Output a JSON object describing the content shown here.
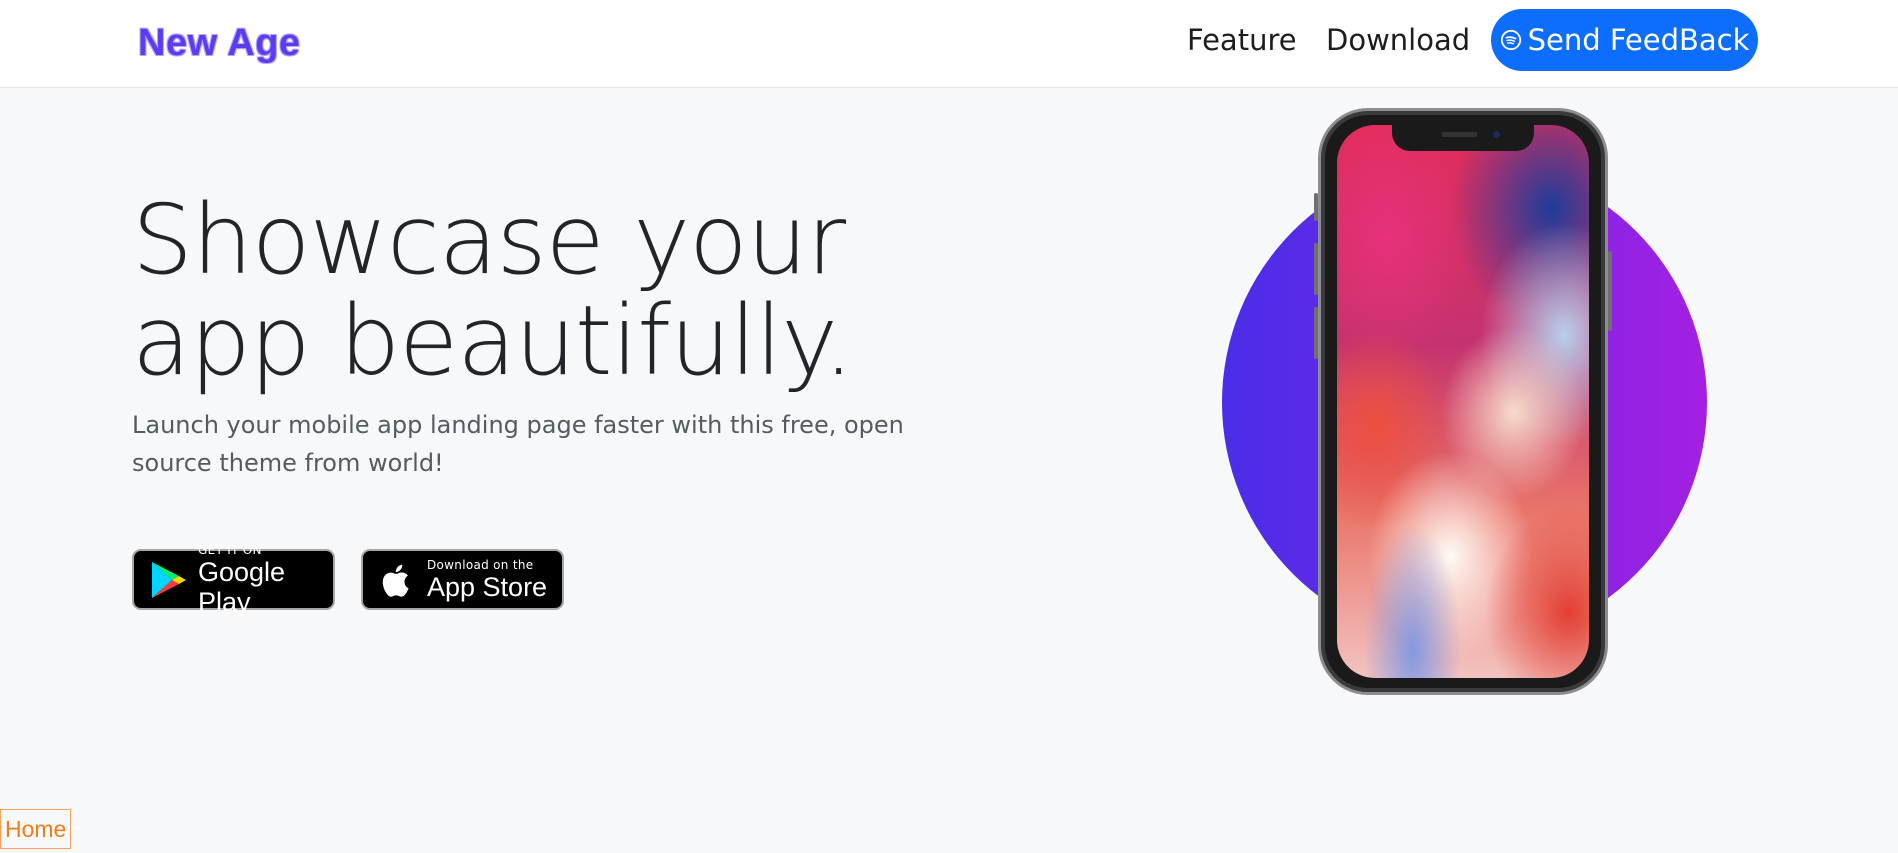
{
  "navbar": {
    "brand": "New Age",
    "links": [
      {
        "label": "Feature"
      },
      {
        "label": "Download"
      }
    ],
    "feedback_button": {
      "label": "Send FeedBack",
      "icon": "spotify-icon",
      "color": "#0d6efd"
    }
  },
  "hero": {
    "title_line1": "Showcase your",
    "title_line2": "app beautifully.",
    "lead": "Launch your mobile app landing page faster with this free, open source theme from world!",
    "badges": {
      "google": {
        "small": "GET IT ON",
        "large": "Google Play",
        "icon": "google-play-icon"
      },
      "apple": {
        "small": "Download on the",
        "large": "App Store",
        "icon": "apple-icon"
      }
    }
  },
  "device": {
    "type": "iphone-x-mockup",
    "circle_gradient": [
      "#4a2de8",
      "#a51fe2"
    ]
  },
  "footer_link": {
    "label": "Home",
    "color": "#f07d1a"
  }
}
